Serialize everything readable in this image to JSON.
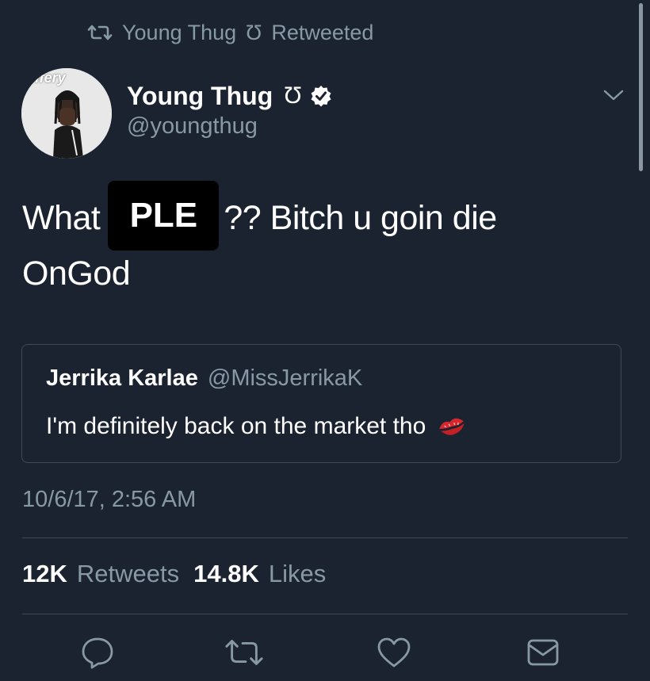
{
  "retweet_context": {
    "user": "Young Thug",
    "glyph": "Ʊ",
    "label": "Retweeted"
  },
  "tweet": {
    "display_name": "Young Thug",
    "name_glyph": "Ʊ",
    "handle": "@youngthug",
    "avatar_watermark": "iffery",
    "verified": true,
    "text_before": "What",
    "redacted_label": "PLE",
    "text_after": "?? Bitch u goin die",
    "text_line2": "OnGod",
    "timestamp": "10/6/17, 2:56 AM"
  },
  "quoted_tweet": {
    "display_name": "Jerrika Karlae",
    "handle": "@MissJerrikaK",
    "text": "I'm definitely back on the market tho",
    "emoji": "kiss-mark-icon"
  },
  "stats": {
    "retweets_count": "12K",
    "retweets_label": "Retweets",
    "likes_count": "14.8K",
    "likes_label": "Likes"
  },
  "actions": [
    "reply-icon",
    "retweet-icon",
    "like-icon",
    "direct-message-icon"
  ],
  "colors": {
    "background": "#1b2330",
    "secondary_text": "#8899a6",
    "divider": "#3d4a57",
    "kiss_red": "#d9262c"
  }
}
